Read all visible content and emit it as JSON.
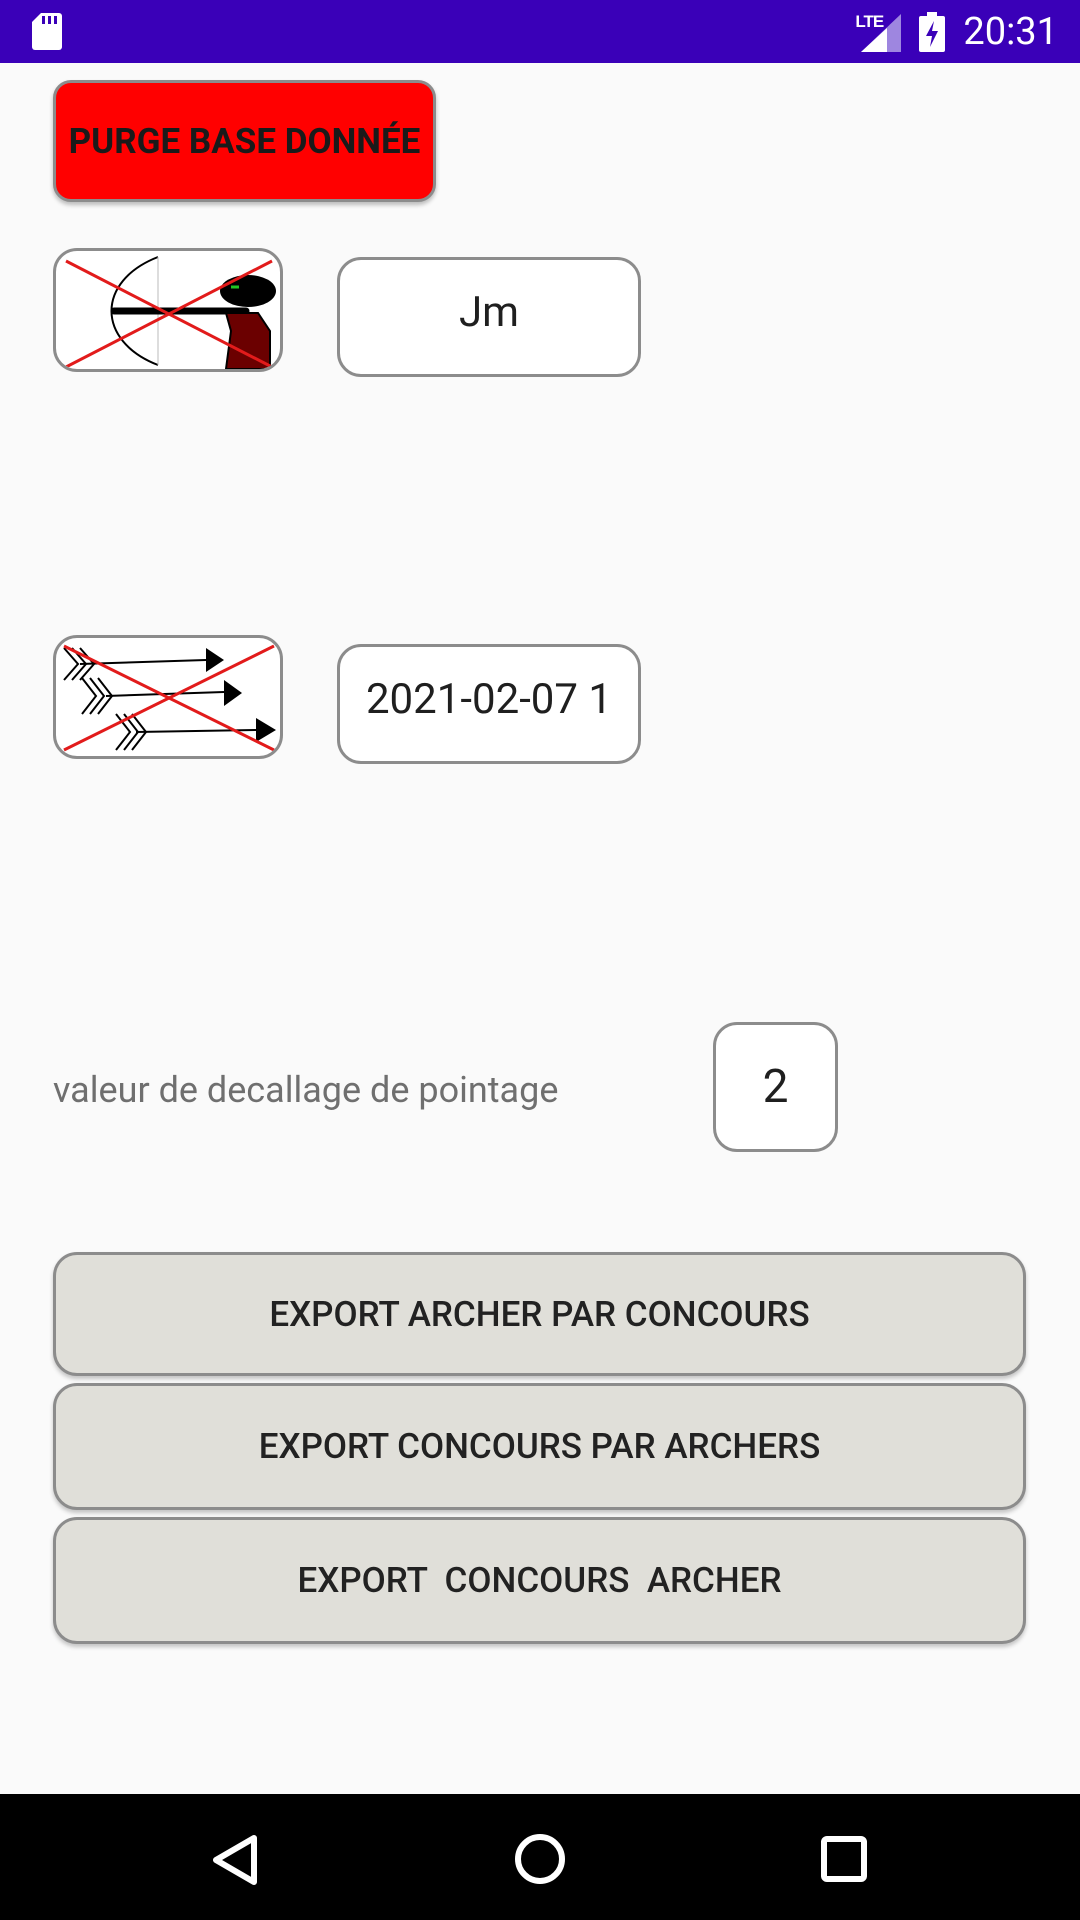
{
  "status_bar": {
    "network": "LTE",
    "time": "20:31",
    "icons": [
      "sd-card-icon",
      "lte-signal-icon",
      "battery-charging-icon"
    ]
  },
  "purge_button": {
    "label": "PURGE BASE DONNÉE",
    "color": "#ff0000"
  },
  "archer_row": {
    "icon": "archer-crossed-icon",
    "value": "Jm"
  },
  "contest_row": {
    "icon": "arrows-crossed-icon",
    "value": "2021-02-07 1"
  },
  "offset": {
    "label": "valeur de decallage de pointage",
    "value": "2"
  },
  "export_buttons": [
    {
      "label": "EXPORT ARCHER PAR CONCOURS"
    },
    {
      "label": "EXPORT CONCOURS PAR ARCHERS"
    },
    {
      "label": "EXPORT  CONCOURS  ARCHER"
    }
  ],
  "nav_bar": {
    "icons": [
      "back-icon",
      "home-icon",
      "recents-icon"
    ]
  },
  "colors": {
    "status_bar": "#3a00b8",
    "background": "#fafafa",
    "button_gray": "#e0dfd9",
    "danger": "#ff0000"
  }
}
